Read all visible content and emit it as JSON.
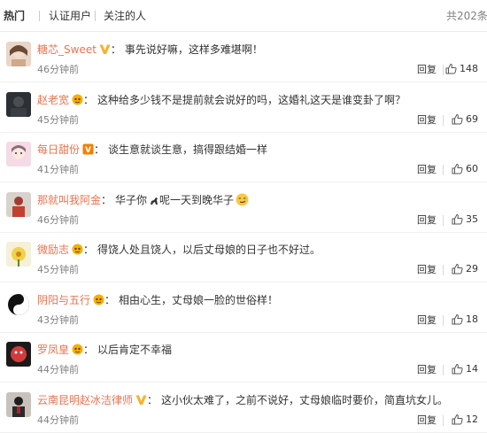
{
  "tabs": [
    {
      "label": "热门",
      "active": true
    },
    {
      "label": "认证用户",
      "active": false
    },
    {
      "label": "关注的人",
      "active": false
    }
  ],
  "total_count": "共202条",
  "reply_label": "回复",
  "colors": {
    "username": "#eb7350",
    "meta": "#808080",
    "verified_gold": "#f8b22b",
    "verified_orange": "#f77d00"
  },
  "comments": [
    {
      "user": "糖芯_Sweet",
      "badge": "gold-v",
      "text": "事先说好嘛，这样多难堪啊！",
      "time": "46分钟前",
      "likes": "148",
      "avatar": "woman-face"
    },
    {
      "user": "赵老宽",
      "badge": "orange-v",
      "text": "这种给多少钱不是提前就会说好的吗，这婚礼这天是谁变卦了啊？",
      "time": "45分钟前",
      "likes": "69",
      "avatar": "dark-portrait"
    },
    {
      "user": "每日甜份",
      "badge": "red-v",
      "text": "谈生意就谈生意，搞得跟结婚一样",
      "time": "41分钟前",
      "likes": "60",
      "avatar": "pink-girl"
    },
    {
      "user": "那就叫我阿金",
      "badge": "",
      "text": "华子你",
      "emoji": "horse",
      "text2": "呢一天到晚华子",
      "emoji2": "smirk-emoji",
      "time": "46分钟前",
      "likes": "35",
      "avatar": "red-figure"
    },
    {
      "user": "微励志",
      "badge": "orange-v",
      "text": "得饶人处且饶人，以后丈母娘的日子也不好过。",
      "time": "45分钟前",
      "likes": "29",
      "avatar": "yellow-flower"
    },
    {
      "user": "阴阳与五行",
      "badge": "orange-v",
      "text": "相由心生，丈母娘一脸的世俗样！",
      "time": "43分钟前",
      "likes": "18",
      "avatar": "yin-yang"
    },
    {
      "user": "罗凤皇",
      "badge": "orange-v",
      "text": "以后肯定不幸福",
      "time": "44分钟前",
      "likes": "14",
      "avatar": "red-face"
    },
    {
      "user": "云南昆明赵冰洁律师",
      "badge": "gold-v",
      "text": "这小伙太难了，之前不说好，丈母娘临时要价，简直坑女儿。",
      "time": "44分钟前",
      "likes": "12",
      "avatar": "lawyer-portrait"
    }
  ]
}
